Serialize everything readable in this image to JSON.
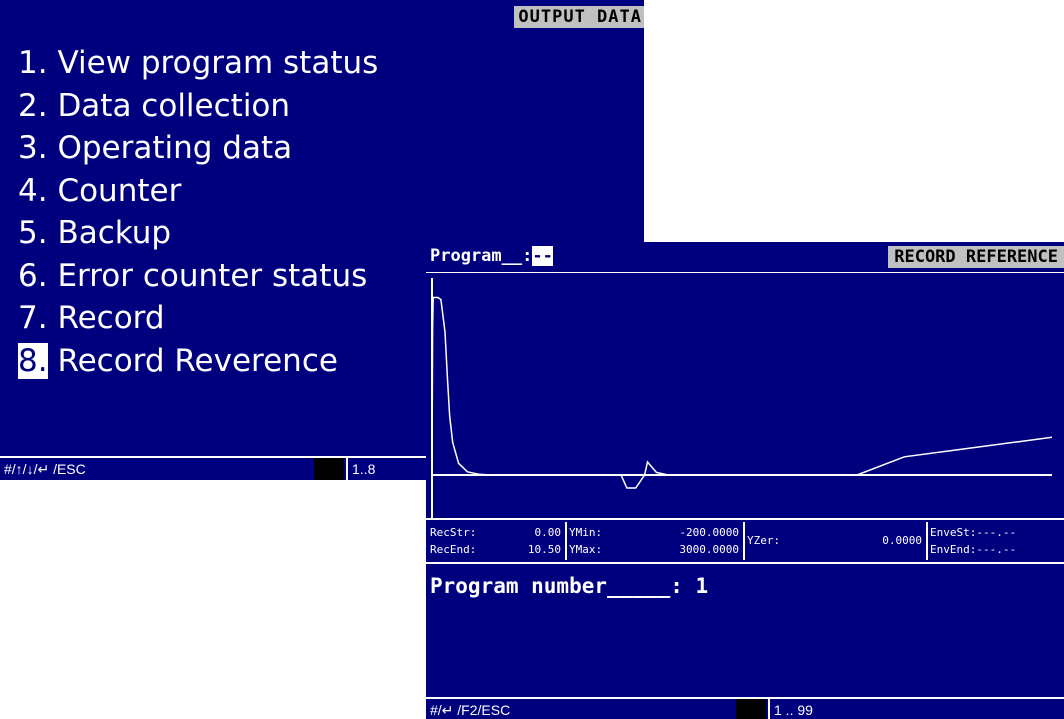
{
  "output_screen": {
    "title": "OUTPUT DATA",
    "menu": [
      {
        "num": "1.",
        "label": "View program status"
      },
      {
        "num": "2.",
        "label": "Data collection"
      },
      {
        "num": "3.",
        "label": "Operating data"
      },
      {
        "num": "4.",
        "label": "Counter"
      },
      {
        "num": "5.",
        "label": "Backup"
      },
      {
        "num": "6.",
        "label": "Error counter status"
      },
      {
        "num": "7.",
        "label": "Record"
      },
      {
        "num": "8.",
        "label": "Record Reverence"
      }
    ],
    "selected_index": 7,
    "status_keys": "#/↑/↓/↵ /ESC",
    "status_range": "1..8"
  },
  "record_screen": {
    "program_label": "Program__:",
    "program_value": "--",
    "title": "RECORD REFERENCE",
    "info": {
      "rec_str_label": "RecStr:",
      "rec_str_value": "0.00",
      "rec_end_label": "RecEnd:",
      "rec_end_value": "10.50",
      "ymin_label": "YMin:",
      "ymin_value": "-200.0000",
      "ymax_label": "YMax:",
      "ymax_value": "3000.0000",
      "yzer_label": "YZer:",
      "yzer_value": "0.0000",
      "envest_label": "EnveSt:",
      "envest_value": "---.--",
      "envend_label": "EnvEnd:",
      "envend_value": "---.--"
    },
    "program_number_label": "Program number_____:",
    "program_number_value": "1",
    "status_keys": "#/↵ /F2/ESC",
    "status_range": "1 .. 99"
  },
  "colors": {
    "background": "#00007f",
    "foreground": "#ffffff",
    "title_bg": "#c0c0c0"
  },
  "chart_data": {
    "type": "line",
    "title": "",
    "xlabel": "",
    "ylabel": "",
    "xlim": [
      0.0,
      10.5
    ],
    "ylim": [
      -200,
      3000
    ],
    "grid": false,
    "series": [
      {
        "x": [
          0.0,
          0.01,
          0.02,
          0.1,
          0.15,
          0.22,
          0.26,
          0.3,
          0.35,
          0.45,
          0.6,
          0.8,
          1.0,
          3.2,
          3.3,
          3.45,
          3.6,
          3.65,
          3.8,
          4.0,
          7.2,
          8.0,
          9.0,
          10.0,
          10.5
        ],
        "y": [
          0,
          2250,
          2730,
          2730,
          2700,
          2200,
          1500,
          900,
          500,
          180,
          50,
          10,
          0,
          0,
          -200,
          -200,
          0,
          200,
          40,
          0,
          0,
          280,
          400,
          520,
          580
        ]
      }
    ]
  }
}
